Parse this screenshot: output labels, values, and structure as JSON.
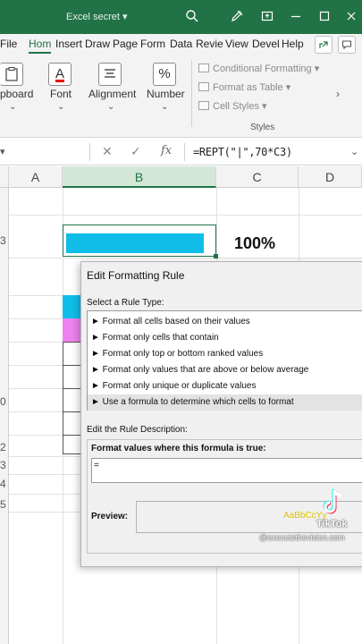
{
  "titlebar": {
    "title": "Excel secret ▾",
    "bg_color": "#217346",
    "icons": [
      "search-icon",
      "pen-icon",
      "restore-icon",
      "minimize-icon",
      "maximize-icon",
      "close-icon"
    ]
  },
  "tabs": {
    "items": [
      "File",
      "Hom",
      "Insert",
      "Draw",
      "Page",
      "Form",
      "Data",
      "Revie",
      "View",
      "Devel",
      "Help"
    ],
    "active": "Hom",
    "right_icons": [
      "share-icon",
      "comment-icon"
    ]
  },
  "ribbon": {
    "clipboard_label": "pboard",
    "font_label": "Font",
    "font_icon": "A",
    "alignment_label": "Alignment",
    "number_label": "Number",
    "number_icon": "%",
    "conditional_formatting": "Conditional Formatting ▾",
    "format_as_table": "Format as Table ▾",
    "cell_styles": "Cell Styles ▾",
    "styles_label": "Styles"
  },
  "formula_bar": {
    "cancel": "✕",
    "enter": "✓",
    "fx": "fx",
    "formula": "=REPT(\"|\",70*C3)"
  },
  "columns": [
    "A",
    "B",
    "C",
    "D"
  ],
  "selected_column": "B",
  "rows": [
    "3",
    "0",
    "2",
    "3",
    "4",
    "5"
  ],
  "cells": {
    "c3_value": "100%",
    "bar_color": "#10bde9",
    "pink_color": "#ee82ee"
  },
  "dialog": {
    "title": "Edit Formatting Rule",
    "select_label": "Select a Rule Type:",
    "rules": [
      "► Format all cells based on their values",
      "► Format only cells that contain",
      "► Format only top or bottom ranked values",
      "► Format only values that are above or below average",
      "► Format only unique or duplicate values",
      "► Use a formula to determine which cells to format"
    ],
    "selected_rule_index": 5,
    "edit_label": "Edit the Rule Description:",
    "formula_label": "Format values where this formula is true:",
    "formula_value": "=",
    "preview_label": "Preview:",
    "preview_sample": "AaBbCcYy"
  },
  "watermark": {
    "app": "TikTok",
    "handle": "@executethevision.com"
  }
}
